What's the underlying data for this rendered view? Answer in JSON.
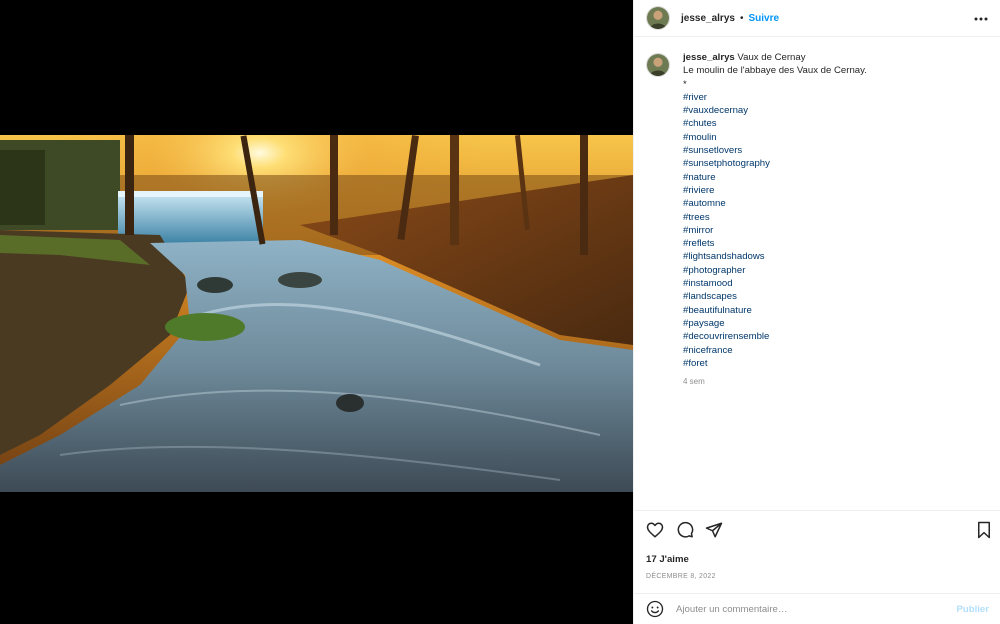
{
  "colors": {
    "accent": "#0095f6",
    "hashtag": "#00376b",
    "muted": "#8e8e8e",
    "publish_disabled": "#b2dffc"
  },
  "media": {
    "subject": "Long-exposure river with waterfall at sunset, autumn forest"
  },
  "header": {
    "avatar_icon": "user-avatar-icon",
    "username": "jesse_alrys",
    "separator": "•",
    "follow_label": "Suivre",
    "more_icon": "more-horizontal-icon"
  },
  "caption": {
    "username": "jesse_alrys",
    "location": "Vaux de Cernay",
    "line": "Le moulin de l'abbaye des Vaux de Cernay.",
    "dot": "*",
    "hashtags": [
      "#river",
      "#vauxdecernay",
      "#chutes",
      "#moulin",
      "#sunsetlovers",
      "#sunsetphotography",
      "#nature",
      "#riviere",
      "#automne",
      "#trees",
      "#mirror",
      "#reflets",
      "#lightsandshadows",
      "#photographer",
      "#instamood",
      "#landscapes",
      "#beautifulnature",
      "#paysage",
      "#decouvrirensemble",
      "#nicefrance",
      "#foret"
    ],
    "time": "4 sem"
  },
  "actions": {
    "like_icon": "heart-icon",
    "comment_icon": "comment-icon",
    "share_icon": "send-icon",
    "save_icon": "bookmark-icon",
    "likes": "17 J'aime",
    "date": "DÉCEMBRE 8, 2022"
  },
  "comment_box": {
    "emoji_icon": "emoji-icon",
    "placeholder": "Ajouter un commentaire…",
    "publish_label": "Publier"
  }
}
